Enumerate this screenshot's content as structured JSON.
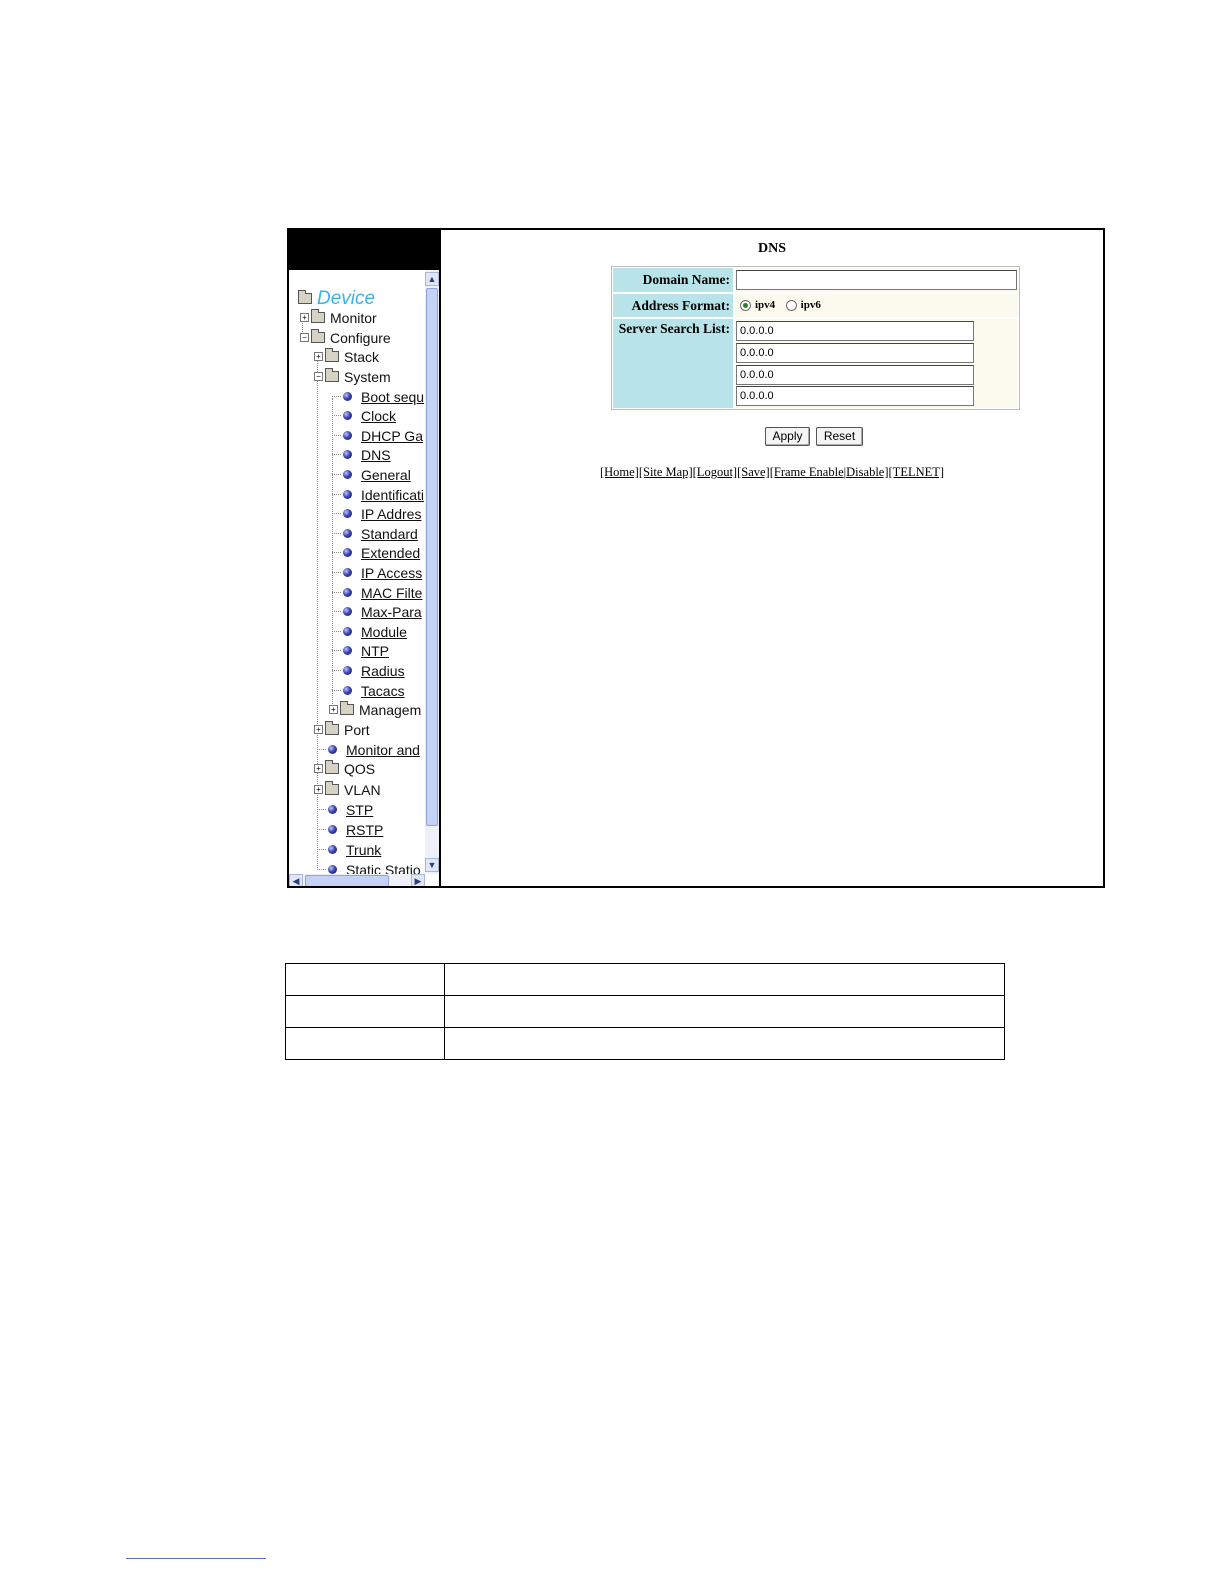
{
  "navigation": {
    "root": "Device",
    "items": [
      {
        "label": "Monitor",
        "type": "folder",
        "expander": "+"
      },
      {
        "label": "Configure",
        "type": "folder",
        "expander": "-"
      },
      {
        "label": "Stack",
        "type": "folder",
        "expander": "+"
      },
      {
        "label": "System",
        "type": "folder",
        "expander": "-"
      },
      {
        "label": "Boot sequ",
        "type": "link"
      },
      {
        "label": "Clock",
        "type": "link"
      },
      {
        "label": "DHCP Ga",
        "type": "link"
      },
      {
        "label": "DNS",
        "type": "link"
      },
      {
        "label": "General",
        "type": "link"
      },
      {
        "label": "Identificati",
        "type": "link"
      },
      {
        "label": "IP Addres",
        "type": "link"
      },
      {
        "label": "Standard",
        "type": "link"
      },
      {
        "label": "Extended",
        "type": "link"
      },
      {
        "label": "IP Access",
        "type": "link"
      },
      {
        "label": "MAC Filte",
        "type": "link"
      },
      {
        "label": "Max-Para",
        "type": "link"
      },
      {
        "label": "Module",
        "type": "link"
      },
      {
        "label": "NTP",
        "type": "link"
      },
      {
        "label": "Radius",
        "type": "link"
      },
      {
        "label": "Tacacs",
        "type": "link"
      },
      {
        "label": "Managem",
        "type": "folder",
        "expander": "+"
      },
      {
        "label": "Port",
        "type": "folder",
        "expander": "+"
      },
      {
        "label": "Monitor and",
        "type": "link"
      },
      {
        "label": "QOS",
        "type": "folder",
        "expander": "+"
      },
      {
        "label": "VLAN",
        "type": "folder",
        "expander": "+"
      },
      {
        "label": "STP",
        "type": "link"
      },
      {
        "label": "RSTP",
        "type": "link"
      },
      {
        "label": "Trunk",
        "type": "link"
      },
      {
        "label": "Static Statio",
        "type": "text"
      }
    ],
    "icons": {
      "expand": "plus-box-icon",
      "collapse": "minus-box-icon",
      "folder": "folder-icon",
      "leaf": "blue-ball-icon"
    }
  },
  "dns_form": {
    "title": "DNS",
    "domain_name_label": "Domain Name:",
    "domain_name_value": "",
    "address_format_label": "Address Format:",
    "address_format_options": [
      {
        "label": "ipv4",
        "selected": true
      },
      {
        "label": "ipv6",
        "selected": false
      }
    ],
    "server_search_list_label": "Server Search List:",
    "servers": [
      "0.0.0.0",
      "0.0.0.0",
      "0.0.0.0",
      "0.0.0.0"
    ],
    "apply_label": "Apply",
    "reset_label": "Reset"
  },
  "footer_links": {
    "home": "[Home]",
    "site_map": "[Site Map]",
    "logout": "[Logout]",
    "save": "[Save]",
    "frame_enable": "[Frame Enable",
    "separator": "|",
    "disable": "Disable]",
    "telnet": "[TELNET]"
  },
  "parameter_table": {
    "rows": [
      [
        "",
        ""
      ],
      [
        "",
        ""
      ],
      [
        "",
        ""
      ]
    ]
  },
  "colors": {
    "form_label_bg": "#b7e3e9",
    "form_value_bg": "#fbfaee",
    "device_text": "#3ab4e8",
    "nav_header": "#000000"
  }
}
